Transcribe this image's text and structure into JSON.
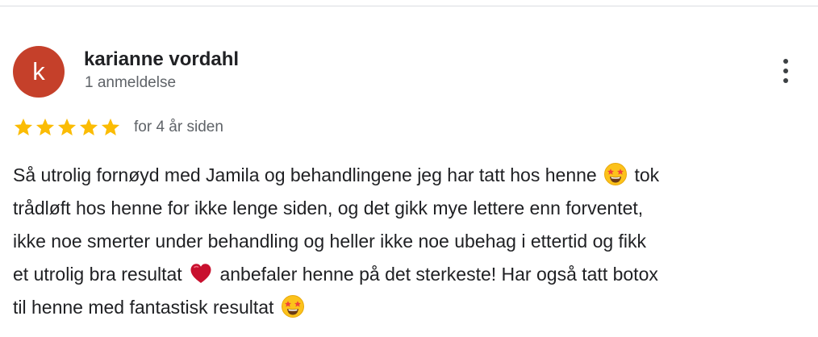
{
  "review": {
    "avatar_letter": "k",
    "avatar_color": "#c5402a",
    "author": "karianne vordahl",
    "review_count": "1 anmeldelse",
    "rating": 5,
    "rating_max": 5,
    "star_color": "#fbbc04",
    "time_ago": "for 4 år siden",
    "more_icon": "more-vert-icon",
    "lines": {
      "l1a": "Så utrolig fornøyd med Jamila og behandlingene jeg har tatt hos henne",
      "l1b": "tok",
      "l2": "trådløft hos henne for ikke lenge siden, og det gikk mye lettere enn forventet,",
      "l3": "ikke noe smerter under behandling og heller ikke noe ubehag i ettertid og fikk",
      "l4a": "et utrolig bra resultat",
      "l4b": "anbefaler henne på det sterkeste! Har også tatt botox",
      "l5a": "til henne med fantastisk resultat"
    },
    "emojis": [
      "star-struck-emoji",
      "red-heart-emoji",
      "star-struck-emoji"
    ]
  }
}
